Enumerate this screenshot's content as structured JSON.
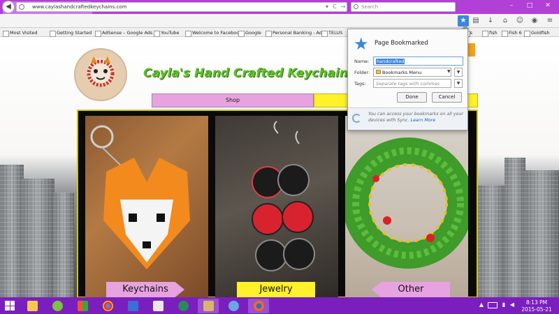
{
  "browser": {
    "tab_title": "handcrafted",
    "tab_close": "×",
    "new_tab": "+",
    "url": "www.caylashandcraftedkeychains.com",
    "search_placeholder": "Search",
    "window_controls": [
      "–",
      "□",
      "✕"
    ],
    "back_glyph": "◀",
    "url_controls": [
      "▾",
      "C",
      "→"
    ]
  },
  "bookmarks_toolbar": [
    "Most Visited",
    "Getting Started",
    "AdSense – Google Ads",
    "YouTube",
    "Welcome to Facebook...",
    "Google",
    "Personal Banking - Ad...",
    "TELUS",
    "rns",
    "fish",
    "Fish 6",
    "Goldfish"
  ],
  "page": {
    "site_title": "Cayla's Hand Crafted Keychains & J",
    "nav_shop": "Shop",
    "labels": {
      "keychains": "Keychains",
      "jewelry": "Jewelry",
      "other": "Other"
    }
  },
  "bookmark_panel": {
    "heading": "Page Bookmarked",
    "name_label": "Name:",
    "name_value": "handcrafted",
    "folder_label": "Folder:",
    "folder_value": "Bookmarks Menu",
    "tags_label": "Tags:",
    "tags_placeholder": "Separate tags with commas",
    "done": "Done",
    "cancel": "Cancel",
    "sync_text": "You can access your bookmarks on all your devices with Sync.",
    "sync_link": "Learn More"
  },
  "taskbar": {
    "time": "8:13 PM",
    "date": "2015-05-21",
    "app_icons": [
      "file-explorer-icon",
      "word-icon",
      "mosaic-app-icon",
      "chrome-icon",
      "mail-app-icon",
      "video-app-icon",
      "media-center-icon",
      "remote-desktop-icon",
      "paint-icon",
      "firefox-icon"
    ]
  },
  "colors": {
    "tab_bar": "#b23fd6",
    "taskbar": "#7a1fbd",
    "site_title": "#5fc02a",
    "nav_pink": "#e6a3df",
    "nav_yellow": "#fff12a",
    "bookmark_star": "#3a86e0"
  }
}
